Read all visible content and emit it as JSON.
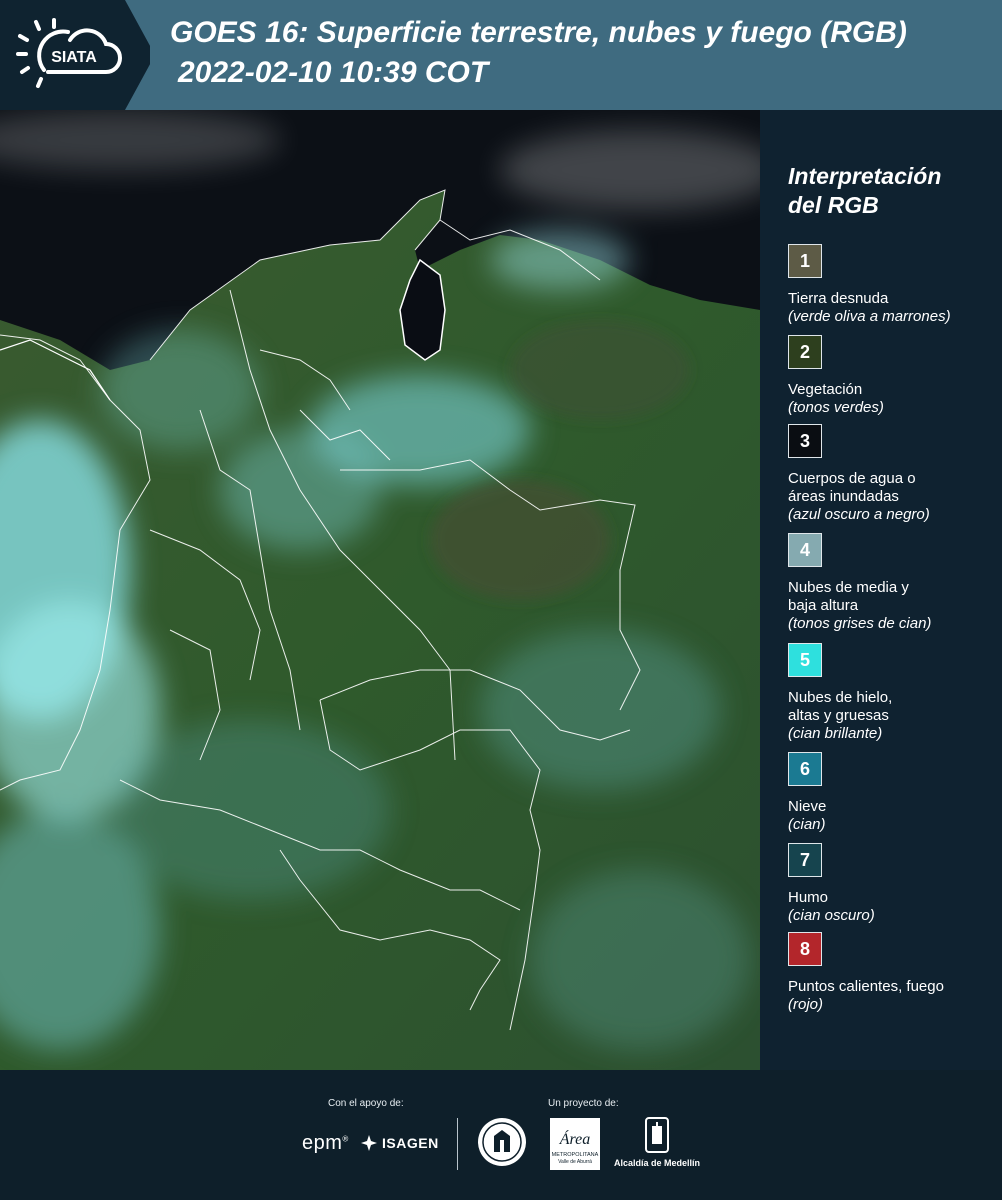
{
  "header": {
    "logo_text": "SIATA",
    "title_line1": "GOES 16: Superficie terrestre, nubes y fuego (RGB)",
    "title_line2": "2022-02-10 10:39 COT"
  },
  "legend": {
    "title_line1": "Interpretación",
    "title_line2": "del RGB",
    "items": [
      {
        "num": "1",
        "color": "#5d5b46",
        "lines": [
          "Tierra desnuda"
        ],
        "note": "(verde oliva a marrones)"
      },
      {
        "num": "2",
        "color": "#2d3f1e",
        "lines": [
          "Vegetación"
        ],
        "note": "(tonos verdes)"
      },
      {
        "num": "3",
        "color": "#0a0d12",
        "lines": [
          "Cuerpos de agua o",
          "áreas inundadas"
        ],
        "note": "(azul oscuro a negro)"
      },
      {
        "num": "4",
        "color": "#85aab0",
        "lines": [
          "Nubes de media y",
          "baja altura"
        ],
        "note": "(tonos grises de cian)"
      },
      {
        "num": "5",
        "color": "#2ee0de",
        "lines": [
          "Nubes de hielo,",
          "altas y gruesas"
        ],
        "note": "(cian brillante)"
      },
      {
        "num": "6",
        "color": "#1b7a92",
        "lines": [
          "Nieve"
        ],
        "note": "(cian)"
      },
      {
        "num": "7",
        "color": "#16444e",
        "lines": [
          "Humo"
        ],
        "note": "(cian oscuro)"
      },
      {
        "num": "8",
        "color": "#b3262b",
        "lines": [
          "Puntos calientes, fuego"
        ],
        "note": "(rojo)"
      }
    ]
  },
  "footer": {
    "support_label": "Con el apoyo de:",
    "project_label": "Un proyecto de:",
    "epm": "epm",
    "isagen": "ISAGEN",
    "area_text": "Área",
    "area_sub1": "METROPOLITANA",
    "area_sub2": "Valle de Aburrá",
    "alcaldia": "Alcaldía de Medellín"
  }
}
